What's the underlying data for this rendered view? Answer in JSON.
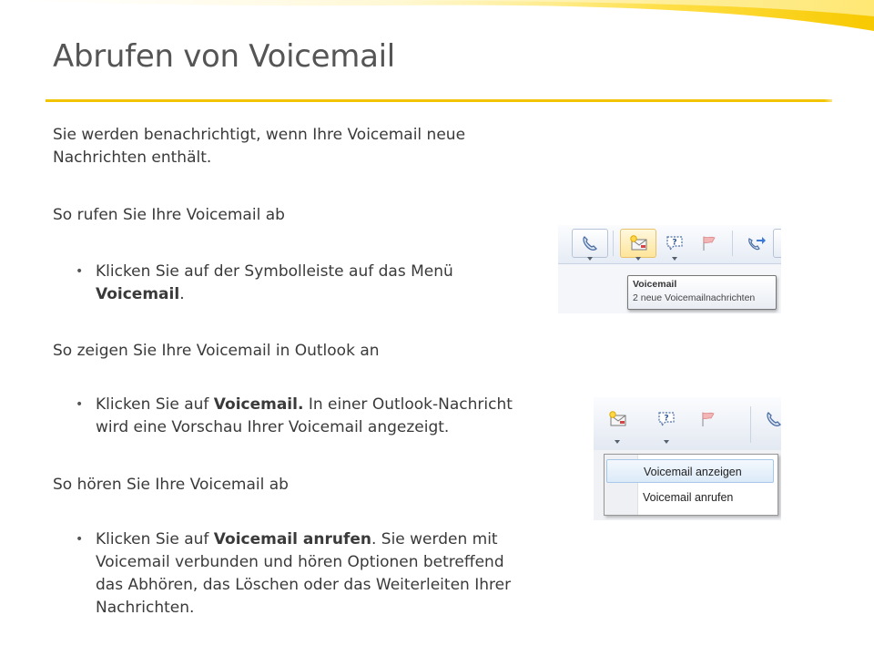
{
  "slide": {
    "title": "Abrufen von Voicemail",
    "intro_line1": "Sie werden benachrichtigt, wenn Ihre Voicemail neue",
    "intro_line2": "Nachrichten enthält.",
    "section1_heading": "So rufen Sie Ihre Voicemail ab",
    "bullet1_line1": "Klicken Sie auf der Symbolleiste auf das Menü",
    "bullet1_bold": "Voicemail",
    "bullet1_end": ".",
    "section2_heading": "So zeigen Sie Ihre Voicemail in Outlook an",
    "bullet2_pre": "Klicken Sie auf ",
    "bullet2_bold": "Voicemail.",
    "bullet2_post": " In einer Outlook-Nachricht",
    "bullet2_line2": "wird eine Vorschau Ihrer Voicemail angezeigt.",
    "section3_heading": "So hören Sie Ihre Voicemail ab",
    "bullet3_pre": "Klicken Sie auf ",
    "bullet3_bold": "Voicemail anrufen",
    "bullet3_post": ". Sie werden mit",
    "bullet3_line2": "Voicemail verbunden und hören Optionen betreffend",
    "bullet3_line3": "das Abhören, das Löschen oder das Weiterleiten Ihrer",
    "bullet3_line4": "Nachrichten."
  },
  "screenshot1": {
    "tooltip_title": "Voicemail",
    "tooltip_subtitle": "2 neue Voicemailnachrichten"
  },
  "screenshot2": {
    "menu_items": [
      "Voicemail anzeigen",
      "Voicemail anrufen"
    ]
  },
  "colors": {
    "accent": "#f2c400",
    "title": "#555555",
    "text": "#3a3a3a"
  },
  "icons": [
    "phone-icon",
    "voicemail-icon",
    "help-chat-icon",
    "flag-icon",
    "phone-forward-icon"
  ]
}
